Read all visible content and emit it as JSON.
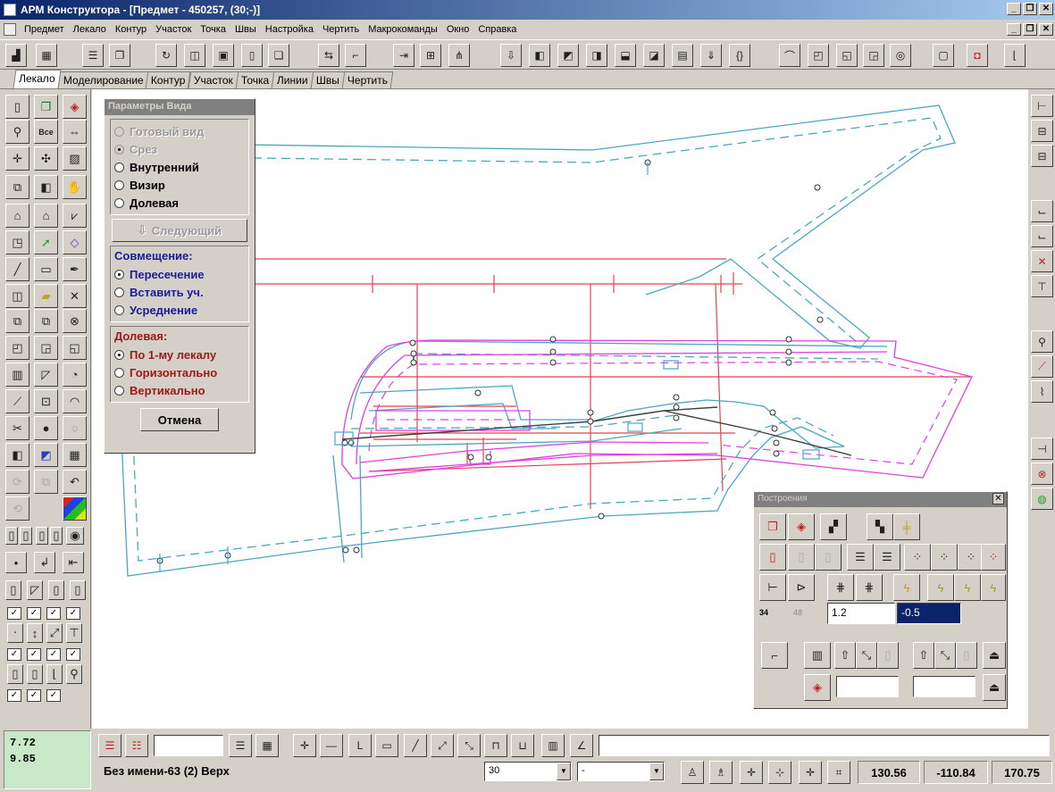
{
  "window": {
    "title": "АРМ Конструктора - [Предмет - 450257, (30;-)]",
    "controls": [
      "_",
      "❐",
      "✕"
    ]
  },
  "menu": [
    "Предмет",
    "Лекало",
    "Контур",
    "Участок",
    "Точка",
    "Швы",
    "Настройка",
    "Чертить",
    "Макрокоманды",
    "Окно",
    "Справка"
  ],
  "mdi_controls": [
    "_",
    "❐",
    "✕"
  ],
  "tabs": [
    {
      "label": "Лекало",
      "active": true
    },
    {
      "label": "Моделирование",
      "active": false
    },
    {
      "label": "Контур",
      "active": false
    },
    {
      "label": "Участок",
      "active": false
    },
    {
      "label": "Точка",
      "active": false
    },
    {
      "label": "Линии",
      "active": false
    },
    {
      "label": "Швы",
      "active": false
    },
    {
      "label": "Чертить",
      "active": false
    }
  ],
  "left_toolbar": {
    "zoom_label": "Все"
  },
  "params_panel": {
    "title": "Параметры Вида",
    "view_options": [
      {
        "label": "Готовый вид",
        "checked": false,
        "disabled": true
      },
      {
        "label": "Срез",
        "checked": true,
        "disabled": true
      },
      {
        "label": "Внутренний",
        "checked": false,
        "disabled": false
      },
      {
        "label": "Визир",
        "checked": false,
        "disabled": false
      },
      {
        "label": "Долевая",
        "checked": false,
        "disabled": false
      }
    ],
    "next_button": "Следующий",
    "alignment": {
      "label": "Совмещение:",
      "options": [
        {
          "label": "Пересечение",
          "checked": true
        },
        {
          "label": "Вставить уч.",
          "checked": false
        },
        {
          "label": "Усреднение",
          "checked": false
        }
      ]
    },
    "grain": {
      "label": "Долевая:",
      "options": [
        {
          "label": "По 1-му лекалу",
          "checked": true
        },
        {
          "label": "Горизонтально",
          "checked": false
        },
        {
          "label": "Вертикально",
          "checked": false
        }
      ]
    },
    "cancel_button": "Отмена"
  },
  "constructor_panel": {
    "title": "Построения",
    "small_labels": [
      "34",
      "48"
    ],
    "input1": "1.2",
    "input2": "-0.5"
  },
  "coords": {
    "x": "7.72",
    "y": "9.85"
  },
  "status": {
    "name": "Без имени-63 (2) Верх",
    "size_value": "30",
    "second_value": "-",
    "readouts": [
      "130.56",
      "-110.84",
      "170.75"
    ]
  },
  "colors": {
    "cyan_line": "#48a8c0",
    "magenta_line": "#e040e0",
    "red_line": "#e84050",
    "title_active": "#0a246a"
  }
}
